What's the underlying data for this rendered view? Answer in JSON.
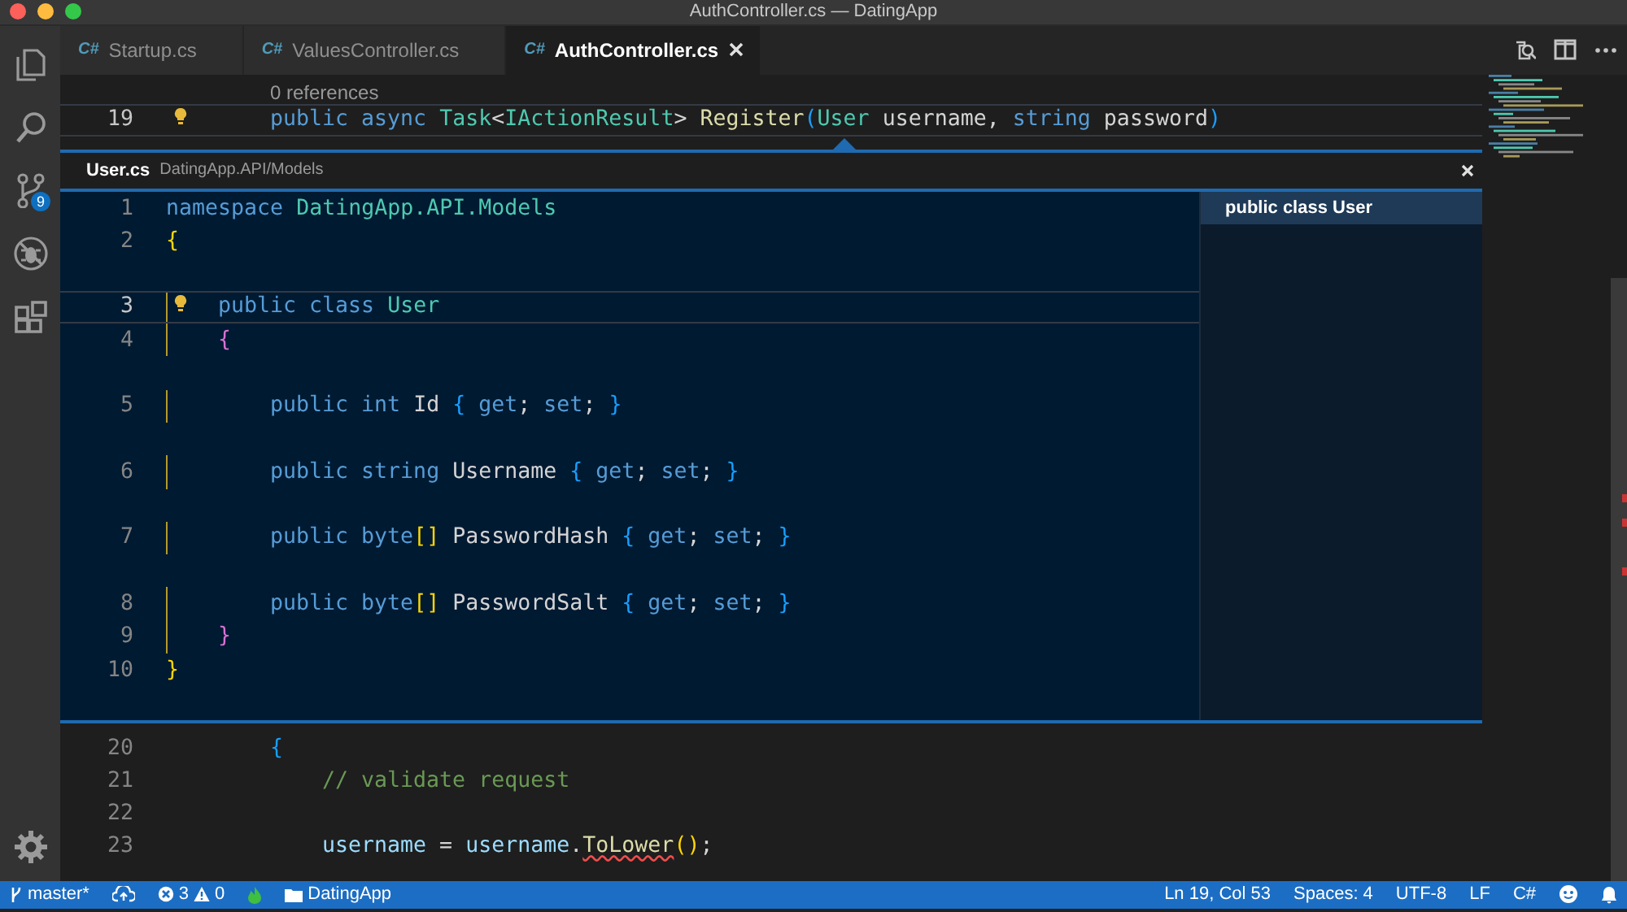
{
  "window": {
    "title": "AuthController.cs — DatingApp"
  },
  "activity_bar": {
    "items": [
      {
        "kind": "files"
      },
      {
        "kind": "search"
      },
      {
        "kind": "source-control",
        "badge": "9"
      },
      {
        "kind": "debug"
      },
      {
        "kind": "extensions"
      }
    ],
    "bottom": [
      {
        "kind": "settings"
      }
    ]
  },
  "tabs": [
    {
      "icon": "C#",
      "label": "Startup.cs",
      "selected": false
    },
    {
      "icon": "C#",
      "label": "ValuesController.cs",
      "selected": false
    },
    {
      "icon": "C#",
      "label": "AuthController.cs",
      "selected": true
    }
  ],
  "editor": {
    "codelens": "0 references",
    "lines_before": [
      {
        "children": [
          {
            "children": [
              {
                "number": "19",
                "lightbulb": true,
                "current": true,
                "tokens": [
                  {
                    "kind": "kw",
                    "t": "public async "
                  },
                  {
                    "kind": "type",
                    "t": "Task"
                  },
                  {
                    "kind": "plain",
                    "t": "<"
                  },
                  {
                    "kind": "type",
                    "t": "IActionResult"
                  },
                  {
                    "kind": "plain",
                    "t": "> "
                  },
                  {
                    "kind": "fn",
                    "t": "Register"
                  },
                  {
                    "kind": "b3",
                    "t": "("
                  },
                  {
                    "kind": "type",
                    "t": "User"
                  },
                  {
                    "kind": "plain",
                    "t": " username, "
                  },
                  {
                    "kind": "kw",
                    "t": "string"
                  },
                  {
                    "kind": "plain",
                    "t": " password"
                  },
                  {
                    "kind": "b3",
                    "t": ")"
                  }
                ]
              }
            ]
          }
        ]
      }
    ],
    "peek": {
      "file": "User.cs",
      "path": "DatingApp.API/Models",
      "lines": [
        {
          "number": "1",
          "tokens": [
            {
              "kind": "kw",
              "t": "namespace "
            },
            {
              "kind": "type",
              "t": "DatingApp.API.Models"
            }
          ]
        },
        {
          "number": "2",
          "tokens": [
            {
              "kind": "b1",
              "t": "{"
            }
          ],
          "children": [
            {
              "number": "3",
              "lens_space": true,
              "lightbulb": true,
              "current": true,
              "guide": true,
              "tokens": [
                {
                  "kind": "kw",
                  "t": "public class "
                },
                {
                  "kind": "type",
                  "t": "User"
                }
              ]
            },
            {
              "number": "4",
              "guide": true,
              "tokens": [
                {
                  "kind": "b2",
                  "t": "{"
                }
              ],
              "children": [
                {
                  "number": "5",
                  "lens_space": true,
                  "guide": true,
                  "tokens": [
                    {
                      "kind": "kw",
                      "t": "public int "
                    },
                    {
                      "kind": "plain",
                      "t": "Id "
                    },
                    {
                      "kind": "b3",
                      "t": "{ "
                    },
                    {
                      "kind": "kw",
                      "t": "get"
                    },
                    {
                      "kind": "plain",
                      "t": "; "
                    },
                    {
                      "kind": "kw",
                      "t": "set"
                    },
                    {
                      "kind": "plain",
                      "t": "; "
                    },
                    {
                      "kind": "b3",
                      "t": "}"
                    }
                  ]
                },
                {
                  "number": "6",
                  "lens_space": true,
                  "guide": true,
                  "tokens": [
                    {
                      "kind": "kw",
                      "t": "public string "
                    },
                    {
                      "kind": "plain",
                      "t": "Username "
                    },
                    {
                      "kind": "b3",
                      "t": "{ "
                    },
                    {
                      "kind": "kw",
                      "t": "get"
                    },
                    {
                      "kind": "plain",
                      "t": "; "
                    },
                    {
                      "kind": "kw",
                      "t": "set"
                    },
                    {
                      "kind": "plain",
                      "t": "; "
                    },
                    {
                      "kind": "b3",
                      "t": "}"
                    }
                  ]
                },
                {
                  "number": "7",
                  "lens_space": true,
                  "guide": true,
                  "tokens": [
                    {
                      "kind": "kw",
                      "t": "public byte"
                    },
                    {
                      "kind": "b1",
                      "t": "[]"
                    },
                    {
                      "kind": "plain",
                      "t": " PasswordHash "
                    },
                    {
                      "kind": "b3",
                      "t": "{ "
                    },
                    {
                      "kind": "kw",
                      "t": "get"
                    },
                    {
                      "kind": "plain",
                      "t": "; "
                    },
                    {
                      "kind": "kw",
                      "t": "set"
                    },
                    {
                      "kind": "plain",
                      "t": "; "
                    },
                    {
                      "kind": "b3",
                      "t": "}"
                    }
                  ]
                },
                {
                  "number": "8",
                  "lens_space": true,
                  "guide": true,
                  "tokens": [
                    {
                      "kind": "kw",
                      "t": "public byte"
                    },
                    {
                      "kind": "b1",
                      "t": "[]"
                    },
                    {
                      "kind": "plain",
                      "t": " PasswordSalt "
                    },
                    {
                      "kind": "b3",
                      "t": "{ "
                    },
                    {
                      "kind": "kw",
                      "t": "get"
                    },
                    {
                      "kind": "plain",
                      "t": "; "
                    },
                    {
                      "kind": "kw",
                      "t": "set"
                    },
                    {
                      "kind": "plain",
                      "t": "; "
                    },
                    {
                      "kind": "b3",
                      "t": "}"
                    }
                  ]
                }
              ]
            },
            {
              "number": "9",
              "guide": true,
              "tokens": [
                {
                  "kind": "b2",
                  "t": "}"
                }
              ]
            }
          ]
        },
        {
          "number": "10",
          "tokens": [
            {
              "kind": "b1",
              "t": "}"
            }
          ]
        }
      ],
      "references": [
        {
          "label": "public class User",
          "selected": true
        }
      ]
    },
    "lines_after": [
      {
        "children": [
          {
            "children": [
              {
                "number": "20",
                "tokens": [
                  {
                    "kind": "b3",
                    "t": "{"
                  }
                ],
                "children": [
                  {
                    "number": "21",
                    "tokens": [
                      {
                        "kind": "comment",
                        "t": "// validate request"
                      }
                    ]
                  },
                  {
                    "number": "22"
                  },
                  {
                    "number": "23",
                    "tokens": [
                      {
                        "kind": "var",
                        "t": "username"
                      },
                      {
                        "kind": "plain",
                        "t": " = "
                      },
                      {
                        "kind": "var",
                        "t": "username"
                      },
                      {
                        "kind": "plain",
                        "t": "."
                      },
                      {
                        "kind": "fn",
                        "t": "ToLower",
                        "error": true
                      },
                      {
                        "kind": "b1",
                        "t": "()"
                      },
                      {
                        "kind": "plain",
                        "t": ";"
                      }
                    ]
                  }
                ]
              }
            ]
          }
        ]
      }
    ]
  },
  "status_bar": {
    "branch": "master*",
    "errors": "3",
    "warnings": "0",
    "folder": "DatingApp",
    "position": "Ln 19, Col 53",
    "indentation": "Spaces: 4",
    "encoding": "UTF-8",
    "eol": "LF",
    "language": "C#"
  }
}
